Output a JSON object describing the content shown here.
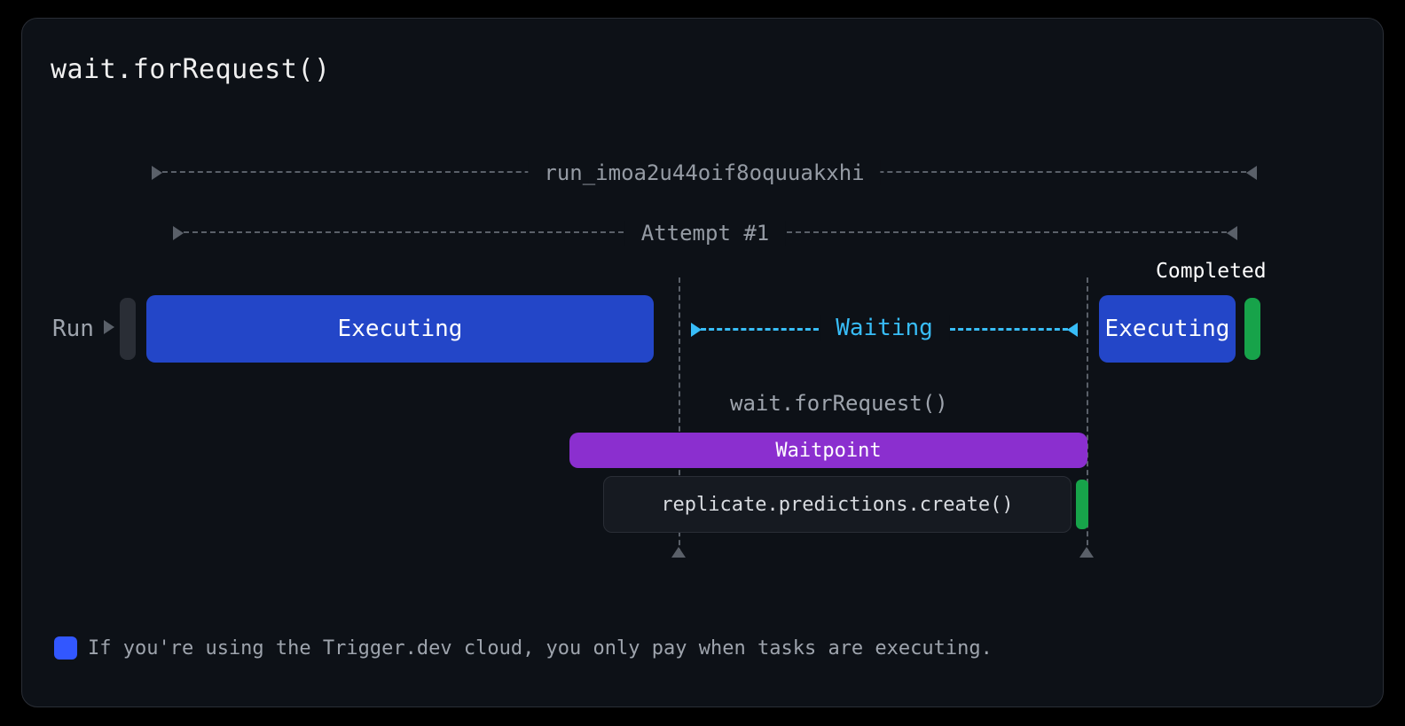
{
  "title": "wait.forRequest()",
  "run_id": "run_imoa2u44oif8oquuakxhi",
  "attempt_label": "Attempt #1",
  "row_label": "Run",
  "completed_label": "Completed",
  "phase": {
    "exec1": "Executing",
    "waiting": "Waiting",
    "exec2": "Executing"
  },
  "wait_call_label": "wait.forRequest()",
  "waitpoint_label": "Waitpoint",
  "rpc_label": "replicate.predictions.create()",
  "footer_note": "If you're using the Trigger.dev cloud, you only pay when tasks are executing.",
  "colors": {
    "executing": "#2346c8",
    "waiting": "#38bdf8",
    "waitpoint": "#8b2fcf",
    "success": "#17a34a"
  }
}
